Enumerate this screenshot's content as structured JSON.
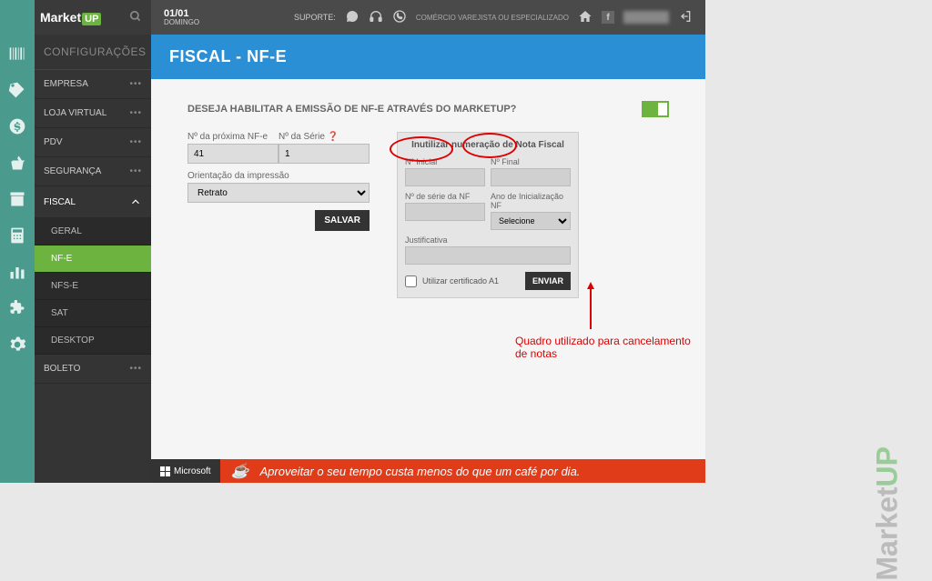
{
  "logo": {
    "brand": "Market",
    "suffix": "UP"
  },
  "topbar": {
    "date": "01/01",
    "weekday": "DOMINGO",
    "support_label": "SUPORTE:",
    "company_type": "COMÉRCIO VAREJISTA OU ESPECIALIZADO",
    "fb": "f"
  },
  "sidebar": {
    "config_header": "CONFIGURAÇÕES",
    "items": [
      {
        "label": "EMPRESA"
      },
      {
        "label": "LOJA VIRTUAL"
      },
      {
        "label": "PDV"
      },
      {
        "label": "SEGURANÇA"
      },
      {
        "label": "FISCAL",
        "expanded": true,
        "sub": [
          {
            "label": "GERAL"
          },
          {
            "label": "NF-E",
            "active": true
          },
          {
            "label": "NFS-E"
          },
          {
            "label": "SAT"
          },
          {
            "label": "DESKTOP"
          }
        ]
      },
      {
        "label": "BOLETO"
      }
    ]
  },
  "page": {
    "title": "FISCAL - NF-E",
    "question": "DESEJA HABILITAR A EMISSÃO DE NF-E ATRAVÉS DO MARKETUP?",
    "fields": {
      "proxima_nfe_label": "Nº da próxima NF-e",
      "proxima_nfe_value": "41",
      "serie_label": "Nº da Série",
      "serie_value": "1",
      "orientacao_label": "Orientação da impressão",
      "orientacao_value": "Retrato"
    },
    "save_btn": "SALVAR",
    "panel": {
      "title": "Inutilizar numeração de Nota Fiscal",
      "n_inicial": "Nº Inicial",
      "n_final": "Nº Final",
      "n_serie": "Nº de série da NF",
      "ano": "Ano de Inicialização NF",
      "ano_value": "Selecione",
      "justificativa": "Justificativa",
      "cert_label": "Utilizar certificado A1",
      "send_btn": "ENVIAR"
    },
    "annotation": "Quadro utilizado para cancelamento de notas"
  },
  "footer": {
    "ms": "Microsoft",
    "ad_text": "Aproveitar o seu tempo custa menos do que um café por dia."
  },
  "watermark": {
    "brand": "Market",
    "suffix": "UP"
  }
}
